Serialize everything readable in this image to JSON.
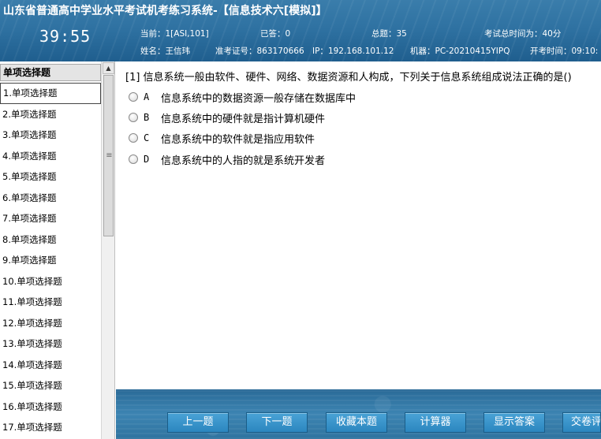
{
  "header": {
    "title": "山东省普通高中学业水平考试机考练习系统-【信息技术六[模拟]】",
    "timer": "39:55",
    "current_label": "当前：",
    "current_value": "1[ASI,101]",
    "answered_label": "已答：",
    "answered_value": "0",
    "total_label": "总题：",
    "total_value": "35",
    "exam_time_label": "考试总时间为：",
    "exam_time_value": "40分",
    "name_label": "姓名：",
    "name_value": "王信玮",
    "ticket_label": "准考证号：",
    "ticket_value": "863170666",
    "ip_label": "IP：",
    "ip_value": "192.168.101.12",
    "machine_label": "机器：",
    "machine_value": "PC-20210415YIPQ",
    "start_label": "开考时间：",
    "start_value": "09:10:"
  },
  "sidebar": {
    "heading": "单项选择题",
    "items": [
      "1.单项选择题",
      "2.单项选择题",
      "3.单项选择题",
      "4.单项选择题",
      "5.单项选择题",
      "6.单项选择题",
      "7.单项选择题",
      "8.单项选择题",
      "9.单项选择题",
      "10.单项选择题",
      "11.单项选择题",
      "12.单项选择题",
      "13.单项选择题",
      "14.单项选择题",
      "15.单项选择题",
      "16.单项选择题",
      "17.单项选择题"
    ],
    "active_index": 0
  },
  "question": {
    "text": "[1] 信息系统一般由软件、硬件、网络、数据资源和人构成，下列关于信息系统组成说法正确的是()",
    "options": [
      {
        "letter": "A",
        "text": "信息系统中的数据资源一般存储在数据库中"
      },
      {
        "letter": "B",
        "text": "信息系统中的硬件就是指计算机硬件"
      },
      {
        "letter": "C",
        "text": "信息系统中的软件就是指应用软件"
      },
      {
        "letter": "D",
        "text": "信息系统中的人指的就是系统开发者"
      }
    ]
  },
  "footer": {
    "prev": "上一题",
    "next": "下一题",
    "favorite": "收藏本题",
    "calculator": "计算器",
    "show_answer": "显示答案",
    "submit": "交卷评分"
  },
  "colors": {
    "header_bg": "#2f72a2",
    "button_bg": "#2b86bf",
    "text_white": "#ffffff"
  }
}
